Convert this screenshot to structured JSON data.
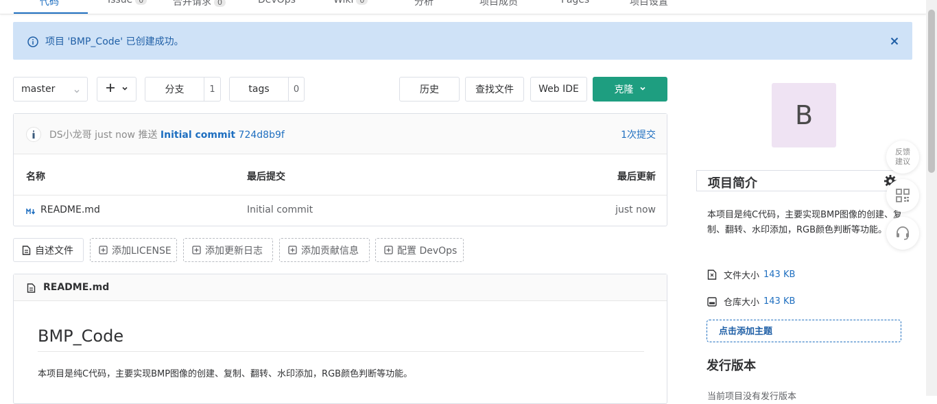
{
  "topnav": {
    "tabs": [
      {
        "label": "代码",
        "active": true
      },
      {
        "label": "Issue",
        "count": "0"
      },
      {
        "label": "合并请求",
        "count": "0"
      },
      {
        "label": "DevOps"
      },
      {
        "label": "Wiki",
        "count": "0"
      },
      {
        "label": "分析"
      },
      {
        "label": "项目成员"
      },
      {
        "label": "Pages"
      },
      {
        "label": "项目设置"
      }
    ]
  },
  "alert": {
    "message": "项目 'BMP_Code' 已创建成功。",
    "icon": "info-icon",
    "close_icon": "close-icon"
  },
  "toolbar": {
    "branch": "master",
    "add_icon": "plus-icon",
    "branches_label": "分支",
    "branches_count": "1",
    "tags_label": "tags",
    "tags_count": "0",
    "history_label": "历史",
    "find_file_label": "查找文件",
    "web_ide_label": "Web IDE",
    "clone_label": "克隆"
  },
  "commit": {
    "author": "DS小龙哥",
    "time": "just now",
    "action": "推送",
    "message": "Initial commit",
    "hash": "724d8b9f",
    "commits_link": "1次提交"
  },
  "file_table": {
    "headers": {
      "name": "名称",
      "last_commit": "最后提交",
      "last_update": "最后更新"
    },
    "rows": [
      {
        "name": "README.md",
        "commit": "Initial commit",
        "time": "just now",
        "icon": "markdown-icon"
      }
    ]
  },
  "actions": {
    "readme": "自述文件",
    "license": "添加LICENSE",
    "changelog": "添加更新日志",
    "contributing": "添加贡献信息",
    "devops": "配置 DevOps"
  },
  "readme": {
    "filename": "README.md",
    "heading": "BMP_Code",
    "body": "本项目是纯C代码，主要实现BMP图像的创建、复制、翻转、水印添加，RGB颜色判断等功能。"
  },
  "sidebar": {
    "avatar_letter": "B",
    "intro_title": "项目简介",
    "intro_desc": "本项目是纯C代码，主要实现BMP图像的创建、复制、翻转、水印添加，RGB颜色判断等功能。",
    "file_size_label": "文件大小",
    "file_size_value": "143 KB",
    "repo_size_label": "仓库大小",
    "repo_size_value": "143 KB",
    "add_topic": "点击添加主题",
    "release_title": "发行版本",
    "release_empty": "当前项目没有发行版本"
  },
  "floating": {
    "feedback_line1": "反馈",
    "feedback_line2": "建议",
    "qr_icon": "qrcode-icon",
    "support_icon": "headset-icon"
  },
  "colors": {
    "accent": "#1f6fc0",
    "clone_button": "#1e9e80",
    "alert_bg": "#cfe2f7",
    "avatar_bg": "#efe3f3"
  }
}
